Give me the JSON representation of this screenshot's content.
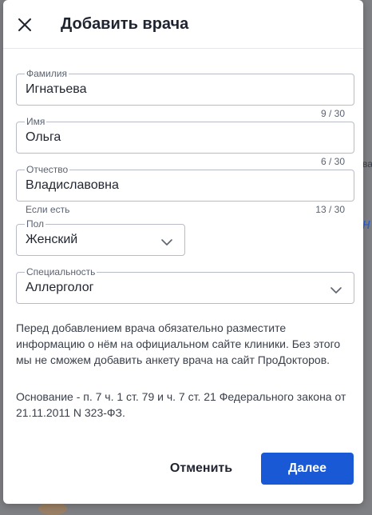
{
  "background": {
    "peek_a": "ва",
    "peek_b": "н"
  },
  "dialog": {
    "title": "Добавить врача",
    "fields": {
      "surname": {
        "label": "Фамилия",
        "value": "Игнатьева",
        "counter": "9 / 30"
      },
      "name": {
        "label": "Имя",
        "value": "Ольга",
        "counter": "6 / 30"
      },
      "patronymic": {
        "label": "Отчество",
        "value": "Владиславовна",
        "counter": "13 / 30",
        "hint": "Если есть"
      },
      "gender": {
        "label": "Пол",
        "value": "Женский"
      },
      "specialty": {
        "label": "Специальность",
        "value": "Аллерголог"
      }
    },
    "info_text": "Перед добавлением врача обязательно разместите информацию о нём на официальном сайте клиники. Без этого мы не сможем добавить анкету врача на сайт ПроДокторов.",
    "basis_text": "Основание - п. 7 ч. 1 ст. 79 и ч. 7 ст. 21 Федерального закона от 21.11.2011 N 323-ФЗ.",
    "buttons": {
      "cancel": "Отменить",
      "next": "Далее"
    },
    "colors": {
      "primary": "#1a59d6",
      "border": "#b8bcc6",
      "muted": "#5b6270"
    },
    "icons": {
      "close": "close-icon",
      "dropdown": "chevron-down-icon"
    }
  }
}
